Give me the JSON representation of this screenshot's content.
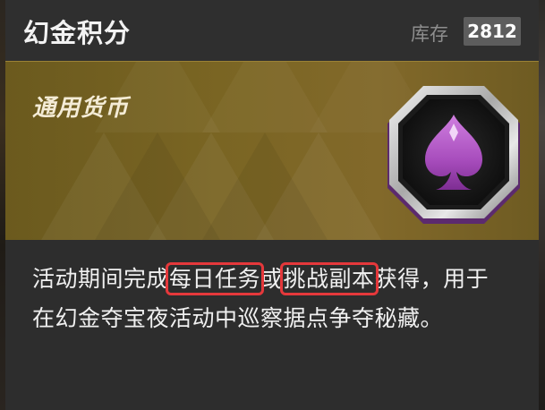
{
  "header": {
    "title": "幻金积分",
    "stock_label": "库存",
    "stock_value": "2812"
  },
  "banner": {
    "label": "通用货币",
    "emblem_icon": "spade-icon"
  },
  "description": {
    "part1": "活动期间完成",
    "highlight1": "每日任务",
    "part2": "或",
    "highlight2": "挑战副本",
    "part3": "获得，用于在幻金夺宝夜活动中巡察据点争夺秘藏。"
  },
  "colors": {
    "banner_gold": "#7a6523",
    "spade_purple": "#b05cc4",
    "highlight_border": "#e5383b"
  }
}
